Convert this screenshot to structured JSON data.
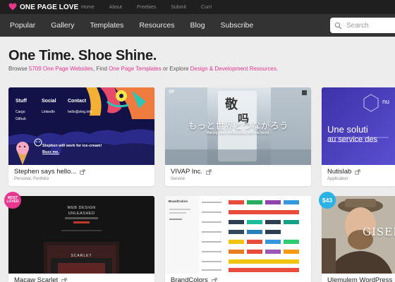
{
  "brand": {
    "name": "ONE PAGE LOVE",
    "accent": "#e8368f"
  },
  "topnav": [
    "Home",
    "About",
    "Freebies",
    "Submit",
    "Curri"
  ],
  "mainnav": [
    "Popular",
    "Gallery",
    "Templates",
    "Resources",
    "Blog",
    "Subscribe"
  ],
  "search": {
    "placeholder": "Search"
  },
  "hero": {
    "title": "One Time. Shoe Shine.",
    "sub_prefix": "Browse ",
    "sub_link1": "5709 One Page Websites",
    "sub_mid1": ", Find ",
    "sub_link2": "One Page Templates",
    "sub_mid2": " or Explore ",
    "sub_link3": "Design & Development Resources",
    "sub_end": "."
  },
  "cards": [
    {
      "title": "Stephen says hello...",
      "tags": "Personal, Portfolio",
      "thumb": {
        "col1_head": "Stuff",
        "col1_items": [
          "Cargo",
          "Github"
        ],
        "col2_head": "Social",
        "col2_items": [
          "LinkedIn"
        ],
        "col3_head": "Contact",
        "col3_items": [
          "hello@stng.info"
        ],
        "msg1": "Stephen will work for ice-cream!",
        "msg2": "Buzz me."
      }
    },
    {
      "title": "VIVAP Inc.",
      "tags": "Service",
      "thumb": {
        "logo": "VP",
        "jp": "もっと世界とつながろう",
        "en": "Making more connections with the world."
      }
    },
    {
      "title": "Nutislab",
      "tags": "Application",
      "thumb": {
        "logo": "nu",
        "line1": "Une soluti",
        "line2": "au service des"
      }
    },
    {
      "title": "Macaw Scarlet",
      "tags": "",
      "badge": "MOST LOVED",
      "thumb": {
        "head1": "WEB DESIGN",
        "head2": "UNLEASHED",
        "product": "SCARLET"
      }
    },
    {
      "title": "BrandColors",
      "tags": "",
      "thumb": {
        "logo": "BrandColors"
      }
    },
    {
      "title": "Ulemulem WordPress",
      "tags": "",
      "badge": "$43",
      "thumb": {
        "name": "GISEL"
      }
    }
  ]
}
